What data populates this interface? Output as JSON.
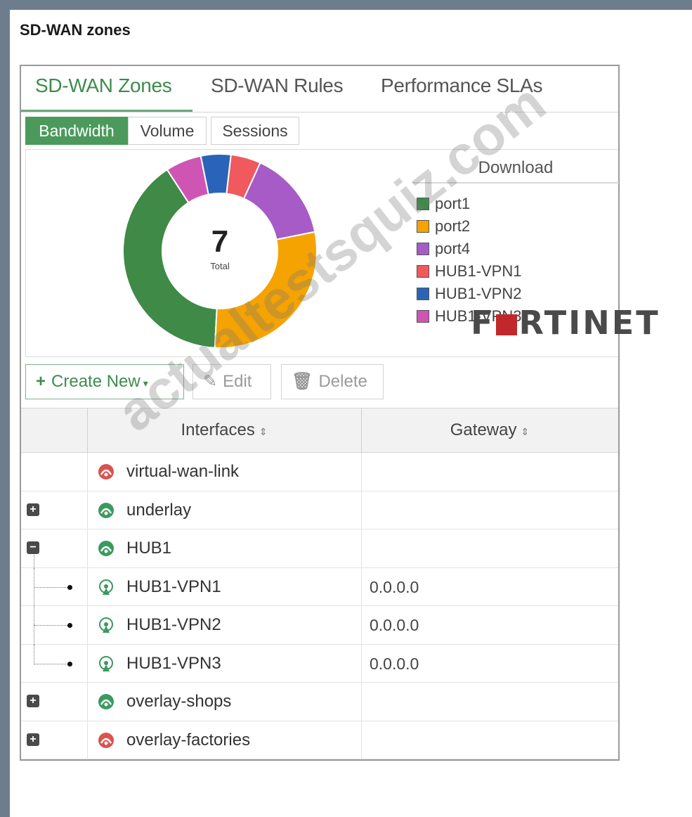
{
  "page": {
    "title": "SD-WAN zones"
  },
  "tabs": [
    {
      "label": "SD-WAN Zones",
      "active": true
    },
    {
      "label": "SD-WAN Rules",
      "active": false
    },
    {
      "label": "Performance SLAs",
      "active": false
    }
  ],
  "subtabs": [
    {
      "label": "Bandwidth",
      "active": true
    },
    {
      "label": "Volume",
      "active": false
    },
    {
      "label": "Sessions",
      "active": false
    }
  ],
  "chart": {
    "total_value": "7",
    "total_label": "Total",
    "legend_title": "Download",
    "legend": [
      {
        "label": "port1",
        "color": "#3e8a46"
      },
      {
        "label": "port2",
        "color": "#f5a300"
      },
      {
        "label": "port4",
        "color": "#a65bc6"
      },
      {
        "label": "HUB1-VPN1",
        "color": "#f0595d"
      },
      {
        "label": "HUB1-VPN2",
        "color": "#2a64b8"
      },
      {
        "label": "HUB1-VPN3",
        "color": "#cf55b5"
      }
    ]
  },
  "chart_data": {
    "type": "pie",
    "donut": true,
    "title": "Download",
    "center_value": "7",
    "center_label": "Total",
    "categories": [
      "port1",
      "port2",
      "port4",
      "HUB1-VPN1",
      "HUB1-VPN2",
      "HUB1-VPN3"
    ],
    "values": [
      40,
      29,
      15,
      5,
      5,
      6
    ],
    "colors": [
      "#3e8a46",
      "#f5a300",
      "#a65bc6",
      "#f0595d",
      "#2a64b8",
      "#cf55b5"
    ],
    "legend_position": "right"
  },
  "toolbar": {
    "create_label": "Create New",
    "edit_label": "Edit",
    "delete_label": "Delete"
  },
  "table": {
    "columns": [
      "Interfaces",
      "Gateway"
    ],
    "rows": [
      {
        "name": "virtual-wan-link",
        "gateway": "",
        "status": "down",
        "expander": "",
        "child": false
      },
      {
        "name": "underlay",
        "gateway": "",
        "status": "up",
        "expander": "+",
        "child": false
      },
      {
        "name": "HUB1",
        "gateway": "",
        "status": "up",
        "expander": "−",
        "child": false
      },
      {
        "name": "HUB1-VPN1",
        "gateway": "0.0.0.0",
        "status": "tunnel",
        "expander": "",
        "child": true
      },
      {
        "name": "HUB1-VPN2",
        "gateway": "0.0.0.0",
        "status": "tunnel",
        "expander": "",
        "child": true
      },
      {
        "name": "HUB1-VPN3",
        "gateway": "0.0.0.0",
        "status": "tunnel",
        "expander": "",
        "child": true
      },
      {
        "name": "overlay-shops",
        "gateway": "",
        "status": "up",
        "expander": "+",
        "child": false
      },
      {
        "name": "overlay-factories",
        "gateway": "",
        "status": "down",
        "expander": "+",
        "child": false
      }
    ]
  },
  "branding": {
    "logo_text": "F■RTINET",
    "watermark": "actualtestsquiz.com"
  },
  "colors": {
    "accent": "#4b9a5c",
    "status_up": "#3b9a60",
    "status_down": "#d9534f"
  }
}
